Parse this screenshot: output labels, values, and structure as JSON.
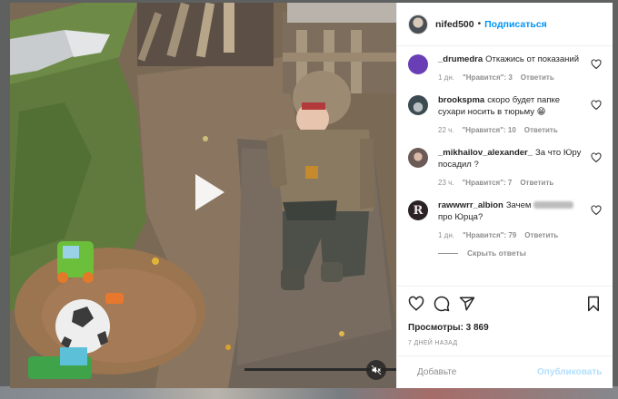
{
  "post": {
    "author": "nifed500",
    "follow_label": "Подписаться",
    "separator": "•"
  },
  "comments": [
    {
      "user": "_drumedra",
      "text": "Откажись от показаний",
      "time": "1 дн.",
      "likes": "\"Нравится\": 3",
      "reply": "Ответить",
      "avatar_color": "#6a3fb5"
    },
    {
      "user": "brookspma",
      "text": "скоро будет папке сухари носить в тюрьму 😁",
      "time": "22 ч.",
      "likes": "\"Нравится\": 10",
      "reply": "Ответить",
      "avatar_color": "#3c4a52"
    },
    {
      "user": "_mikhailov_alexander_",
      "text": "За что Юру посадил ?",
      "time": "23 ч.",
      "likes": "\"Нравится\": 7",
      "reply": "Ответить",
      "avatar_color": "#6b5a55"
    },
    {
      "user": "rawwwrr_albion",
      "text_before": "Зачем",
      "text_after": "про Юрца?",
      "time": "1 дн.",
      "likes": "\"Нравится\": 79",
      "reply": "Ответить",
      "avatar_color": "#2a2224",
      "avatar_letter": "R"
    }
  ],
  "hide_replies_label": "Скрыть ответы",
  "stats": {
    "views": "Просмотры: 3 869",
    "posted_ago": "7 ДНЕЙ НАЗАД"
  },
  "comment_box": {
    "placeholder": "Добавьте",
    "publish_label": "Опубликовать"
  },
  "icons": {
    "like": "heart-icon",
    "comment": "comment-bubble-icon",
    "share": "paper-plane-icon",
    "save": "bookmark-icon",
    "emoji": "smiley-icon",
    "play": "play-icon",
    "mute": "speaker-muted-icon"
  },
  "colors": {
    "link": "#0095f6",
    "muted_text": "#8e8e8e",
    "publish_disabled": "#b2dffc"
  }
}
